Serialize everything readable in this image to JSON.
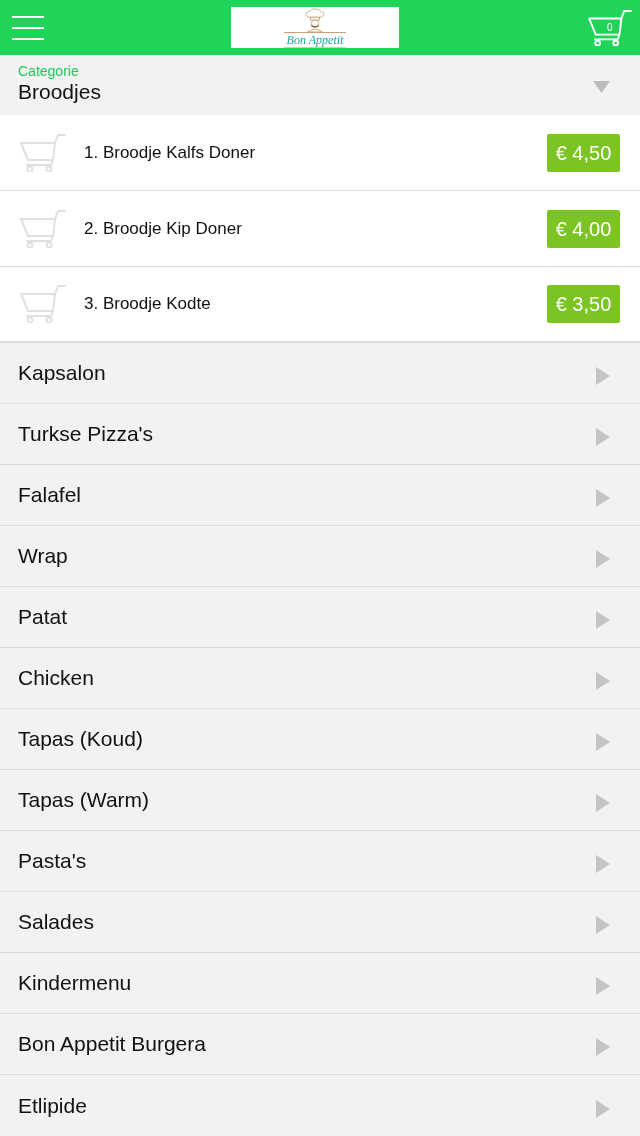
{
  "header": {
    "logo_text": "Bon Appetit",
    "cart_count": "0"
  },
  "selected_category": {
    "label": "Categorie",
    "name": "Broodjes",
    "expanded": true,
    "products": [
      {
        "name": "1. Broodje Kalfs Doner",
        "price": "€ 4,50"
      },
      {
        "name": "2. Broodje Kip Doner",
        "price": "€ 4,00"
      },
      {
        "name": "3. Broodje Kodte",
        "price": "€ 3,50"
      }
    ]
  },
  "categories": [
    {
      "name": "Kapsalon",
      "expanded": false
    },
    {
      "name": "Turkse Pizza's",
      "expanded": false
    },
    {
      "name": "Falafel",
      "expanded": false
    },
    {
      "name": "Wrap",
      "expanded": false
    },
    {
      "name": "Patat",
      "expanded": false
    },
    {
      "name": "Chicken",
      "expanded": false
    },
    {
      "name": "Tapas (Koud)",
      "expanded": false
    },
    {
      "name": "Tapas (Warm)",
      "expanded": false
    },
    {
      "name": "Pasta's",
      "expanded": false
    },
    {
      "name": "Salades",
      "expanded": false
    },
    {
      "name": "Kindermenu",
      "expanded": false
    },
    {
      "name": "Bon Appetit Burgera",
      "expanded": false
    },
    {
      "name": "Etlipide",
      "expanded": false
    }
  ]
}
